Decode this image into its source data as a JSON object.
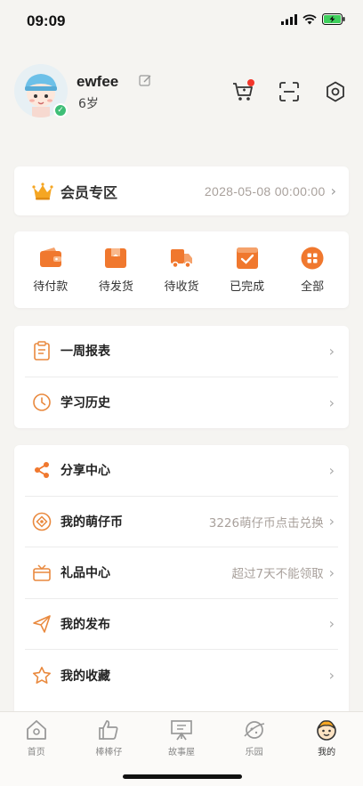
{
  "status": {
    "time": "09:09"
  },
  "profile": {
    "name": "ewfee",
    "age": "6岁"
  },
  "vip": {
    "title": "会员专区",
    "expiry": "2028-05-08 00:00:00"
  },
  "orders": [
    {
      "label": "待付款",
      "icon": "wallet-icon"
    },
    {
      "label": "待发货",
      "icon": "package-icon"
    },
    {
      "label": "待收货",
      "icon": "truck-icon"
    },
    {
      "label": "已完成",
      "icon": "check-box-icon"
    },
    {
      "label": "全部",
      "icon": "grid-icon"
    }
  ],
  "report": [
    {
      "label": "一周报表",
      "icon": "clipboard-icon"
    },
    {
      "label": "学习历史",
      "icon": "clock-icon"
    }
  ],
  "menu": [
    {
      "label": "分享中心",
      "icon": "share-icon",
      "extra": ""
    },
    {
      "label": "我的萌仔币",
      "icon": "coin-icon",
      "extra": "3226萌仔币点击兑换"
    },
    {
      "label": "礼品中心",
      "icon": "gift-icon",
      "extra": "超过7天不能领取"
    },
    {
      "label": "我的发布",
      "icon": "paper-plane-icon",
      "extra": ""
    },
    {
      "label": "我的收藏",
      "icon": "star-icon",
      "extra": ""
    }
  ],
  "tabs": [
    {
      "label": "首页",
      "icon": "home-icon"
    },
    {
      "label": "棒棒仔",
      "icon": "thumbs-up-icon"
    },
    {
      "label": "故事屋",
      "icon": "easel-icon"
    },
    {
      "label": "乐园",
      "icon": "planet-icon"
    },
    {
      "label": "我的",
      "icon": "kid-face-icon"
    }
  ],
  "colors": {
    "accent": "#f0782e",
    "background": "#f5f4f1",
    "muted": "#a9a19c"
  }
}
